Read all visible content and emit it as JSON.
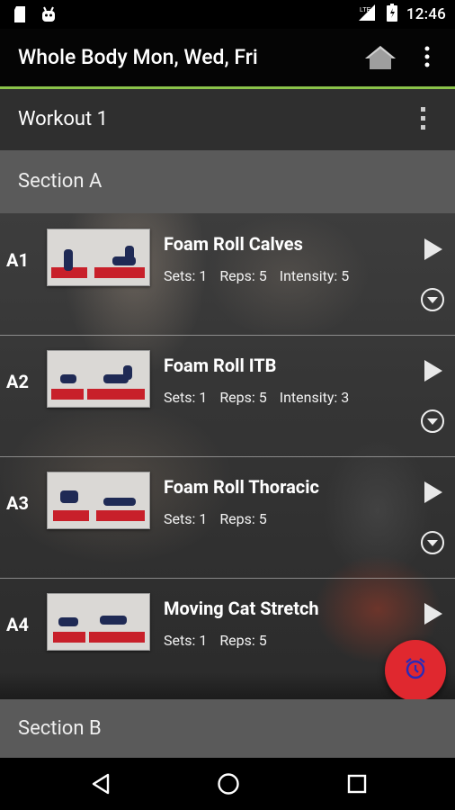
{
  "status_bar": {
    "time": "12:46",
    "icons": [
      "sd-card-icon",
      "android-debug-icon",
      "signal-icon",
      "battery-icon"
    ]
  },
  "app_bar": {
    "title": "Whole Body Mon, Wed, Fri",
    "icons": [
      "home-icon",
      "more-vert-icon"
    ],
    "accent_color": "#8bc34a"
  },
  "workout": {
    "title": "Workout 1",
    "icons": [
      "more-vert-icon"
    ]
  },
  "sections": [
    {
      "title": "Section A",
      "exercises": [
        {
          "code": "A1",
          "name": "Foam Roll Calves",
          "stats": [
            "Sets: 1",
            "Reps: 5",
            "Intensity: 5"
          ]
        },
        {
          "code": "A2",
          "name": "Foam Roll ITB",
          "stats": [
            "Sets: 1",
            "Reps: 5",
            "Intensity: 3"
          ]
        },
        {
          "code": "A3",
          "name": "Foam Roll Thoracic",
          "stats": [
            "Sets: 1",
            "Reps: 5"
          ]
        },
        {
          "code": "A4",
          "name": "Moving Cat Stretch",
          "stats": [
            "Sets: 1",
            "Reps: 5"
          ]
        }
      ]
    },
    {
      "title": "Section B",
      "exercises": []
    }
  ],
  "fab": {
    "icon": "alarm-clock-icon",
    "color": "#e0282f"
  },
  "nav_bar": {
    "icons": [
      "back-icon",
      "home-circle-icon",
      "recents-icon"
    ]
  }
}
